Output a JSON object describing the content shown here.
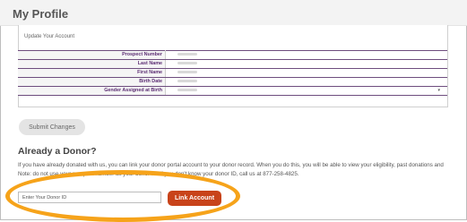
{
  "page": {
    "title": "My Profile"
  },
  "profile_panel": {
    "heading": "Update Your Account",
    "fields": [
      {
        "label": "Prospect Number",
        "value": ""
      },
      {
        "label": "Last Name",
        "value": ""
      },
      {
        "label": "First Name",
        "value": ""
      },
      {
        "label": "Birth Date",
        "value": ""
      },
      {
        "label": "Gender Assigned at Birth",
        "value": "",
        "control": "select"
      }
    ],
    "dropdown_caret": "▾"
  },
  "actions": {
    "submit_label": "Submit Changes"
  },
  "donor": {
    "title": "Already a Donor?",
    "paragraph_1": "If you have already donated with us, you can link your donor portal account to your donor record. When you do this, you will be able to view your eligibility, past donations and",
    "paragraph_2": "Note: do not use your prospect number as your donor ID. If you don't know your donor ID, call us at 877-258-4825.",
    "input_placeholder": "Enter Your Donor ID",
    "link_label": "Link Account"
  },
  "colors": {
    "accent_purple": "#5b2c72",
    "link_button": "#c8431a",
    "highlight": "#f6a31a"
  }
}
